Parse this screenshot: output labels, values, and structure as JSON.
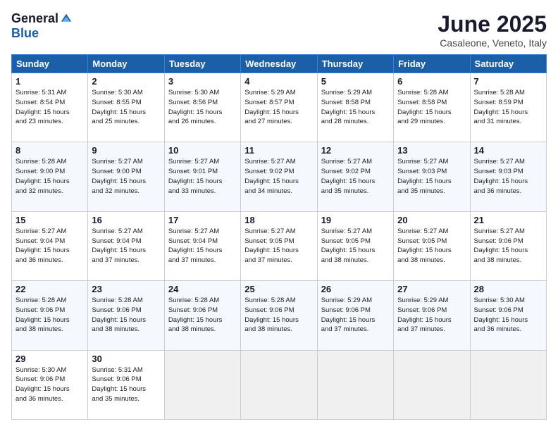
{
  "header": {
    "logo_general": "General",
    "logo_blue": "Blue",
    "title": "June 2025",
    "location": "Casaleone, Veneto, Italy"
  },
  "weekdays": [
    "Sunday",
    "Monday",
    "Tuesday",
    "Wednesday",
    "Thursday",
    "Friday",
    "Saturday"
  ],
  "weeks": [
    [
      {
        "day": "1",
        "info": "Sunrise: 5:31 AM\nSunset: 8:54 PM\nDaylight: 15 hours\nand 23 minutes."
      },
      {
        "day": "2",
        "info": "Sunrise: 5:30 AM\nSunset: 8:55 PM\nDaylight: 15 hours\nand 25 minutes."
      },
      {
        "day": "3",
        "info": "Sunrise: 5:30 AM\nSunset: 8:56 PM\nDaylight: 15 hours\nand 26 minutes."
      },
      {
        "day": "4",
        "info": "Sunrise: 5:29 AM\nSunset: 8:57 PM\nDaylight: 15 hours\nand 27 minutes."
      },
      {
        "day": "5",
        "info": "Sunrise: 5:29 AM\nSunset: 8:58 PM\nDaylight: 15 hours\nand 28 minutes."
      },
      {
        "day": "6",
        "info": "Sunrise: 5:28 AM\nSunset: 8:58 PM\nDaylight: 15 hours\nand 29 minutes."
      },
      {
        "day": "7",
        "info": "Sunrise: 5:28 AM\nSunset: 8:59 PM\nDaylight: 15 hours\nand 31 minutes."
      }
    ],
    [
      {
        "day": "8",
        "info": "Sunrise: 5:28 AM\nSunset: 9:00 PM\nDaylight: 15 hours\nand 32 minutes."
      },
      {
        "day": "9",
        "info": "Sunrise: 5:27 AM\nSunset: 9:00 PM\nDaylight: 15 hours\nand 32 minutes."
      },
      {
        "day": "10",
        "info": "Sunrise: 5:27 AM\nSunset: 9:01 PM\nDaylight: 15 hours\nand 33 minutes."
      },
      {
        "day": "11",
        "info": "Sunrise: 5:27 AM\nSunset: 9:02 PM\nDaylight: 15 hours\nand 34 minutes."
      },
      {
        "day": "12",
        "info": "Sunrise: 5:27 AM\nSunset: 9:02 PM\nDaylight: 15 hours\nand 35 minutes."
      },
      {
        "day": "13",
        "info": "Sunrise: 5:27 AM\nSunset: 9:03 PM\nDaylight: 15 hours\nand 35 minutes."
      },
      {
        "day": "14",
        "info": "Sunrise: 5:27 AM\nSunset: 9:03 PM\nDaylight: 15 hours\nand 36 minutes."
      }
    ],
    [
      {
        "day": "15",
        "info": "Sunrise: 5:27 AM\nSunset: 9:04 PM\nDaylight: 15 hours\nand 36 minutes."
      },
      {
        "day": "16",
        "info": "Sunrise: 5:27 AM\nSunset: 9:04 PM\nDaylight: 15 hours\nand 37 minutes."
      },
      {
        "day": "17",
        "info": "Sunrise: 5:27 AM\nSunset: 9:04 PM\nDaylight: 15 hours\nand 37 minutes."
      },
      {
        "day": "18",
        "info": "Sunrise: 5:27 AM\nSunset: 9:05 PM\nDaylight: 15 hours\nand 37 minutes."
      },
      {
        "day": "19",
        "info": "Sunrise: 5:27 AM\nSunset: 9:05 PM\nDaylight: 15 hours\nand 38 minutes."
      },
      {
        "day": "20",
        "info": "Sunrise: 5:27 AM\nSunset: 9:05 PM\nDaylight: 15 hours\nand 38 minutes."
      },
      {
        "day": "21",
        "info": "Sunrise: 5:27 AM\nSunset: 9:06 PM\nDaylight: 15 hours\nand 38 minutes."
      }
    ],
    [
      {
        "day": "22",
        "info": "Sunrise: 5:28 AM\nSunset: 9:06 PM\nDaylight: 15 hours\nand 38 minutes."
      },
      {
        "day": "23",
        "info": "Sunrise: 5:28 AM\nSunset: 9:06 PM\nDaylight: 15 hours\nand 38 minutes."
      },
      {
        "day": "24",
        "info": "Sunrise: 5:28 AM\nSunset: 9:06 PM\nDaylight: 15 hours\nand 38 minutes."
      },
      {
        "day": "25",
        "info": "Sunrise: 5:28 AM\nSunset: 9:06 PM\nDaylight: 15 hours\nand 38 minutes."
      },
      {
        "day": "26",
        "info": "Sunrise: 5:29 AM\nSunset: 9:06 PM\nDaylight: 15 hours\nand 37 minutes."
      },
      {
        "day": "27",
        "info": "Sunrise: 5:29 AM\nSunset: 9:06 PM\nDaylight: 15 hours\nand 37 minutes."
      },
      {
        "day": "28",
        "info": "Sunrise: 5:30 AM\nSunset: 9:06 PM\nDaylight: 15 hours\nand 36 minutes."
      }
    ],
    [
      {
        "day": "29",
        "info": "Sunrise: 5:30 AM\nSunset: 9:06 PM\nDaylight: 15 hours\nand 36 minutes."
      },
      {
        "day": "30",
        "info": "Sunrise: 5:31 AM\nSunset: 9:06 PM\nDaylight: 15 hours\nand 35 minutes."
      },
      {
        "day": "",
        "info": ""
      },
      {
        "day": "",
        "info": ""
      },
      {
        "day": "",
        "info": ""
      },
      {
        "day": "",
        "info": ""
      },
      {
        "day": "",
        "info": ""
      }
    ]
  ]
}
